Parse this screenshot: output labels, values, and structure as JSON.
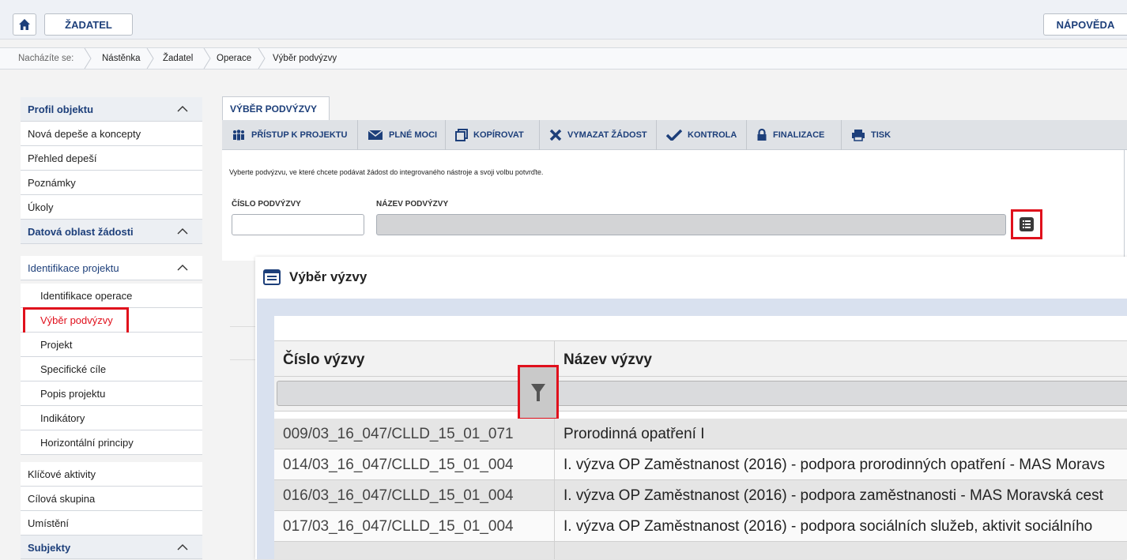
{
  "header": {
    "applicant_label": "ŽADATEL",
    "help_label": "NÁPOVĚDA"
  },
  "breadcrumb": {
    "prefix": "Nacházíte se:",
    "items": [
      "Nástěnka",
      "Žadatel",
      "Operace",
      "Výběr podvýzvy"
    ]
  },
  "sidebar": {
    "items": [
      {
        "label": "Profil objektu",
        "type": "head"
      },
      {
        "label": "Nová depeše a koncepty",
        "type": "item"
      },
      {
        "label": "Přehled depeší",
        "type": "item"
      },
      {
        "label": "Poznámky",
        "type": "item"
      },
      {
        "label": "Úkoly",
        "type": "item"
      },
      {
        "label": "Datová oblast žádosti",
        "type": "head"
      },
      {
        "label": "Identifikace projektu",
        "type": "subhead"
      },
      {
        "label": "Identifikace operace",
        "type": "sub"
      },
      {
        "label": "Výběr podvýzvy",
        "type": "sub-active"
      },
      {
        "label": "Projekt",
        "type": "sub"
      },
      {
        "label": "Specifické cíle",
        "type": "sub"
      },
      {
        "label": "Popis projektu",
        "type": "sub"
      },
      {
        "label": "Indikátory",
        "type": "sub"
      },
      {
        "label": "Horizontální principy",
        "type": "sub"
      },
      {
        "label": "Klíčové aktivity",
        "type": "item"
      },
      {
        "label": "Cílová skupina",
        "type": "item"
      },
      {
        "label": "Umístění",
        "type": "item"
      },
      {
        "label": "Subjekty",
        "type": "head"
      }
    ]
  },
  "main": {
    "tab_label": "VÝBĚR PODVÝZVY",
    "toolbar": {
      "access": "PŘÍSTUP K PROJEKTU",
      "power": "PLNÉ MOCI",
      "copy": "KOPÍROVAT",
      "delete": "VYMAZAT ŽÁDOST",
      "check": "KONTROLA",
      "finalize": "FINALIZACE",
      "print": "TISK"
    },
    "instruction": "Vyberte podvýzvu, ve které chcete podávat žádost do integrovaného nástroje a svoji volbu potvrďte.",
    "number_label": "ČÍSLO PODVÝZVY",
    "name_label": "NÁZEV PODVÝZVY",
    "number_value": "",
    "name_value": ""
  },
  "dialog": {
    "title": "Výběr výzvy",
    "columns": [
      "Číslo výzvy",
      "Název výzvy"
    ],
    "rows": [
      {
        "number": "009/03_16_047/CLLD_15_01_071",
        "name": "Prorodinná opatření I"
      },
      {
        "number": "014/03_16_047/CLLD_15_01_004",
        "name": "I. výzva OP Zaměstnanost (2016) - podpora prorodinných opatření - MAS Moravs"
      },
      {
        "number": "016/03_16_047/CLLD_15_01_004",
        "name": "I. výzva OP Zaměstnanost (2016) - podpora zaměstnanosti - MAS Moravská cest"
      },
      {
        "number": "017/03_16_047/CLLD_15_01_004",
        "name": "I. výzva OP Zaměstnanost (2016) - podpora sociálních služeb, aktivit sociálního"
      }
    ]
  },
  "colors": {
    "brand_blue": "#1d3f7a",
    "highlight_red": "#e0101c"
  }
}
